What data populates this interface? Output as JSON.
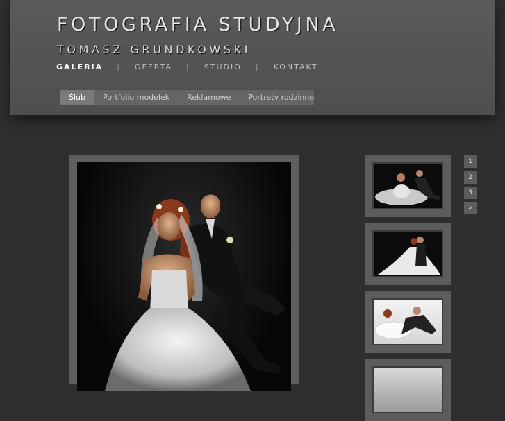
{
  "header": {
    "title": "FOTOGRAFIA STUDYJNA",
    "subtitle": "TOMASZ GRUNDKOWSKI"
  },
  "main_nav": {
    "items": [
      {
        "label": "GALERIA",
        "active": true
      },
      {
        "label": "OFERTA",
        "active": false
      },
      {
        "label": "STUDIO",
        "active": false
      },
      {
        "label": "KONTAKT",
        "active": false
      }
    ],
    "separator": "|"
  },
  "sub_nav": {
    "tabs": [
      {
        "label": "Ślub",
        "active": true
      },
      {
        "label": "Portfolio modelek",
        "active": false
      },
      {
        "label": "Reklamowe",
        "active": false
      },
      {
        "label": "Portrety rodzinne",
        "active": false
      }
    ]
  },
  "pagination": {
    "pages": [
      "1",
      "2",
      "3"
    ],
    "next_symbol": "»"
  },
  "colors": {
    "background": "#2f2f2f",
    "header": "#555555",
    "frame": "#5e5e5e"
  }
}
